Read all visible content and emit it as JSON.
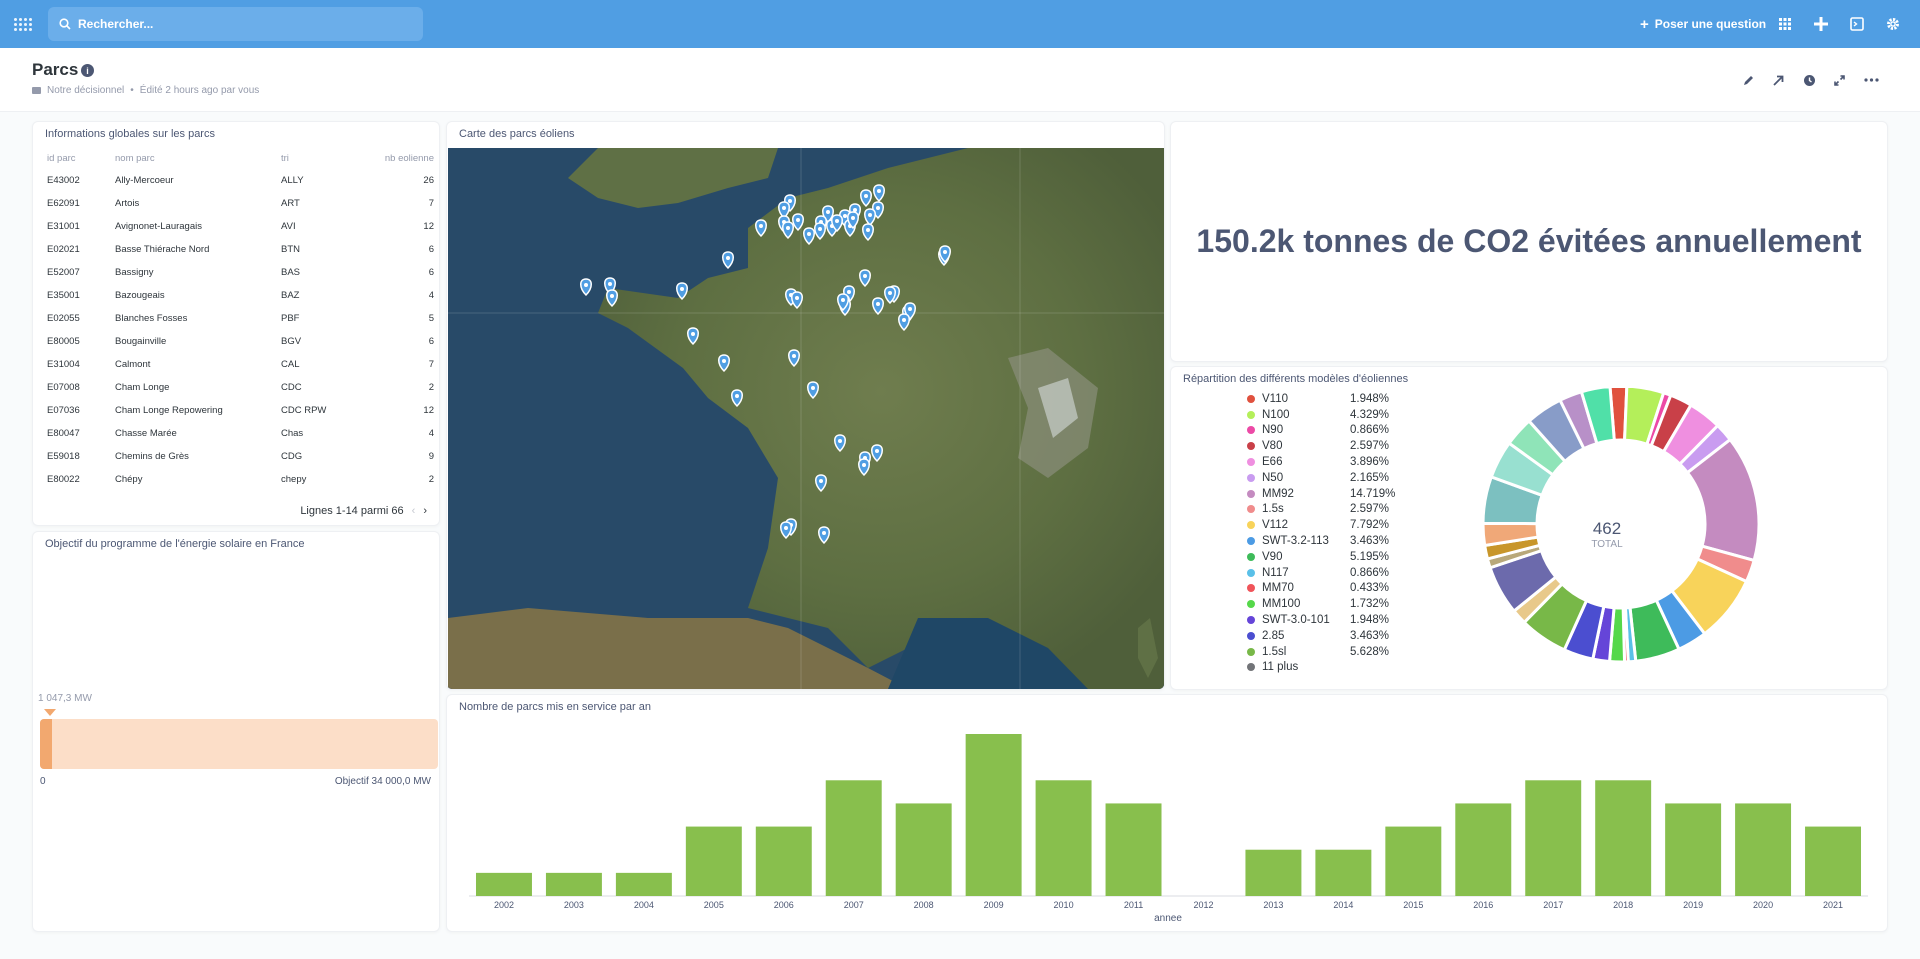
{
  "topbar": {
    "search_placeholder": "Rechercher...",
    "new_question_label": "Poser une question"
  },
  "header": {
    "title": "Parcs",
    "collection": "Notre décisionnel",
    "edited": "Édité 2 hours ago par vous"
  },
  "table_card": {
    "title": "Informations globales sur les parcs",
    "columns": [
      "id parc",
      "nom parc",
      "tri",
      "nb eolienne"
    ],
    "rows": [
      [
        "E43002",
        "Ally-Mercoeur",
        "ALLY",
        "26"
      ],
      [
        "E62091",
        "Artois",
        "ART",
        "7"
      ],
      [
        "E31001",
        "Avignonet-Lauragais",
        "AVI",
        "12"
      ],
      [
        "E02021",
        "Basse Thiérache Nord",
        "BTN",
        "6"
      ],
      [
        "E52007",
        "Bassigny",
        "BAS",
        "6"
      ],
      [
        "E35001",
        "Bazougeais",
        "BAZ",
        "4"
      ],
      [
        "E02055",
        "Blanches Fosses",
        "PBF",
        "5"
      ],
      [
        "E80005",
        "Bougainville",
        "BGV",
        "6"
      ],
      [
        "E31004",
        "Calmont",
        "CAL",
        "7"
      ],
      [
        "E07008",
        "Cham Longe",
        "CDC",
        "2"
      ],
      [
        "E07036",
        "Cham Longe Repowering",
        "CDC RPW",
        "12"
      ],
      [
        "E80047",
        "Chasse Marée",
        "Chas",
        "4"
      ],
      [
        "E59018",
        "Chemins de Grès",
        "CDG",
        "9"
      ],
      [
        "E80022",
        "Chépy",
        "chepy",
        "2"
      ]
    ],
    "pager": "Lignes 1-14 parmi 66"
  },
  "progress_card": {
    "title": "Objectif du programme de l'énergie solaire en France",
    "value_label": "1 047,3 MW",
    "value": 1047.3,
    "goal": 34000,
    "min_label": "0",
    "goal_label": "Objectif 34 000,0 MW",
    "fill_color": "#f2a86f"
  },
  "map_card": {
    "title": "Carte des parcs éoliens",
    "pin_color": "#509ee3"
  },
  "scalar_card": {
    "text": "150.2k tonnes de CO2 évitées annuellement"
  },
  "donut_card": {
    "title": "Répartition des différents modèles d'éoliennes",
    "total_value": "462",
    "total_label": "TOTAL",
    "legend": [
      {
        "name": "V110",
        "pct": "1.948%",
        "color": "#e0513e"
      },
      {
        "name": "N100",
        "pct": "4.329%",
        "color": "#b4ef5a"
      },
      {
        "name": "N90",
        "pct": "0.866%",
        "color": "#ec4aa6"
      },
      {
        "name": "V80",
        "pct": "2.597%",
        "color": "#c94048"
      },
      {
        "name": "E66",
        "pct": "3.896%",
        "color": "#ef8fe0"
      },
      {
        "name": "N50",
        "pct": "2.165%",
        "color": "#c99cf0"
      },
      {
        "name": "MM92",
        "pct": "14.719%",
        "color": "#c48bc0"
      },
      {
        "name": "1.5s",
        "pct": "2.597%",
        "color": "#f08c8c"
      },
      {
        "name": "V112",
        "pct": "7.792%",
        "color": "#f8d35a"
      },
      {
        "name": "SWT-3.2-113",
        "pct": "3.463%",
        "color": "#4c9be4"
      },
      {
        "name": "V90",
        "pct": "5.195%",
        "color": "#3ebb5a"
      },
      {
        "name": "N117",
        "pct": "0.866%",
        "color": "#5ac0e8"
      },
      {
        "name": "MM70",
        "pct": "0.433%",
        "color": "#f0545a"
      },
      {
        "name": "MM100",
        "pct": "1.732%",
        "color": "#55d84a"
      },
      {
        "name": "SWT-3.0-101",
        "pct": "1.948%",
        "color": "#6545d8"
      },
      {
        "name": "2.85",
        "pct": "3.463%",
        "color": "#4b4ed0"
      },
      {
        "name": "1.5sl",
        "pct": "5.628%",
        "color": "#78b848"
      },
      {
        "name": "11 plus",
        "pct": "",
        "color": "#727478"
      }
    ],
    "donut_other_colors": [
      "#e8c98a",
      "#6c6aac",
      "#b8a87a",
      "#c8962a",
      "#f0a878",
      "#7cc0c0",
      "#98e0d0",
      "#8fe4b8",
      "#889cc8",
      "#b890c8",
      "#50e0a8"
    ]
  },
  "bar_card": {
    "title": "Nombre de parcs mis en service par an",
    "chart_data": {
      "type": "bar",
      "categories": [
        "2002",
        "2003",
        "2004",
        "2005",
        "2006",
        "2007",
        "2008",
        "2009",
        "2010",
        "2011",
        "2012",
        "2013",
        "2014",
        "2015",
        "2016",
        "2017",
        "2018",
        "2019",
        "2020",
        "2021"
      ],
      "values": [
        1,
        1,
        1,
        3,
        3,
        5,
        4,
        7,
        5,
        4,
        0,
        2,
        2,
        3,
        4,
        5,
        5,
        4,
        4,
        3
      ],
      "xlabel": "annee",
      "ylabel": "",
      "bar_color": "#88bf4d"
    }
  }
}
